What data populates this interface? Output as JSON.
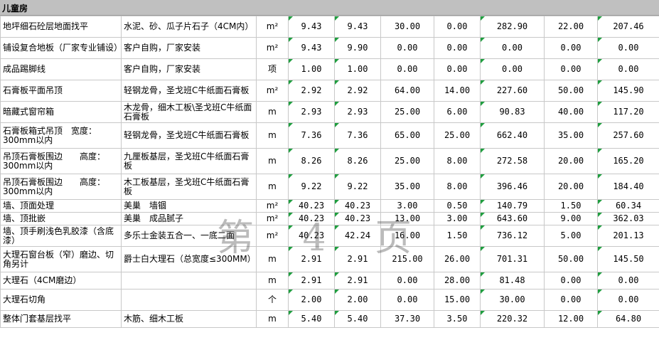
{
  "section": {
    "title": "儿童房"
  },
  "watermark": "第 4 页",
  "rows": [
    {
      "name": "地坪细石砼层地面找平",
      "material": "水泥、砂、瓜子片石子（4CM内）",
      "unit": "m²",
      "v1": "9.43",
      "v2": "9.43",
      "v3": "30.00",
      "v4": "0.00",
      "v5": "282.90",
      "v6": "22.00",
      "v7": "207.46"
    },
    {
      "name": "铺设复合地板（厂家专业铺设）",
      "material": "客户自购，厂家安装",
      "unit": "m²",
      "v1": "9.43",
      "v2": "9.90",
      "v3": "0.00",
      "v4": "0.00",
      "v5": "0.00",
      "v6": "0.00",
      "v7": "0.00"
    },
    {
      "name": "成品踢脚线",
      "material": "客户自购，厂家安装",
      "unit": "项",
      "v1": "1.00",
      "v2": "1.00",
      "v3": "0.00",
      "v4": "0.00",
      "v5": "0.00",
      "v6": "0.00",
      "v7": "0.00"
    },
    {
      "name": "石膏板平面吊顶",
      "material": "轻钢龙骨，圣戈班C牛纸面石膏板",
      "unit": "m²",
      "v1": "2.92",
      "v2": "2.92",
      "v3": "64.00",
      "v4": "14.00",
      "v5": "227.60",
      "v6": "50.00",
      "v7": "145.90"
    },
    {
      "name": "暗藏式窗帘箱",
      "material": "木龙骨，细木工板\\圣戈班C牛纸面石膏板",
      "unit": "m",
      "v1": "2.93",
      "v2": "2.93",
      "v3": "25.00",
      "v4": "6.00",
      "v5": "90.83",
      "v6": "40.00",
      "v7": "117.20"
    },
    {
      "name": "石膏板箱式吊顶　宽度：300mm以内",
      "material": "轻钢龙骨，圣戈班C牛纸面石膏板",
      "unit": "m",
      "v1": "7.36",
      "v2": "7.36",
      "v3": "65.00",
      "v4": "25.00",
      "v5": "662.40",
      "v6": "35.00",
      "v7": "257.60"
    },
    {
      "name": "吊顶石膏板围边　　高度：300mm以内",
      "material": "九厘板基层，圣戈班C牛纸面石膏板",
      "unit": "m",
      "v1": "8.26",
      "v2": "8.26",
      "v3": "25.00",
      "v4": "8.00",
      "v5": "272.58",
      "v6": "20.00",
      "v7": "165.20"
    },
    {
      "name": "吊顶石膏板围边　　高度：300mm以内",
      "material": "木工板基层，圣戈班C牛纸面石膏板",
      "unit": "m",
      "v1": "9.22",
      "v2": "9.22",
      "v3": "35.00",
      "v4": "8.00",
      "v5": "396.46",
      "v6": "20.00",
      "v7": "184.40"
    },
    {
      "name": "墙、顶面处理",
      "material": "美巢　墙锢",
      "unit": "m²",
      "v1": "40.23",
      "v2": "40.23",
      "v3": "3.00",
      "v4": "0.50",
      "v5": "140.79",
      "v6": "1.50",
      "v7": "60.34"
    },
    {
      "name": "墙、顶批嵌",
      "material": "美巢　成品腻子",
      "unit": "m²",
      "v1": "40.23",
      "v2": "40.23",
      "v3": "13.00",
      "v4": "3.00",
      "v5": "643.60",
      "v6": "9.00",
      "v7": "362.03"
    },
    {
      "name": "墙、顶手刷浅色乳胶漆（含底漆）",
      "material": "多乐士金装五合一、一底二面",
      "unit": "m²",
      "v1": "40.23",
      "v2": "42.24",
      "v3": "16.00",
      "v4": "1.50",
      "v5": "736.12",
      "v6": "5.00",
      "v7": "201.13"
    },
    {
      "name": "大理石窗台板（窄）磨边、切角另计",
      "material": "爵士白大理石（总宽度≤300MM）",
      "unit": "m",
      "v1": "2.91",
      "v2": "2.91",
      "v3": "215.00",
      "v4": "26.00",
      "v5": "701.31",
      "v6": "50.00",
      "v7": "145.50"
    },
    {
      "name": "大理石（4CM磨边）",
      "material": "",
      "unit": "m",
      "v1": "2.91",
      "v2": "2.91",
      "v3": "0.00",
      "v4": "28.00",
      "v5": "81.48",
      "v6": "0.00",
      "v7": "0.00"
    },
    {
      "name": "大理石切角",
      "material": "",
      "unit": "个",
      "v1": "2.00",
      "v2": "2.00",
      "v3": "0.00",
      "v4": "15.00",
      "v5": "30.00",
      "v6": "0.00",
      "v7": "0.00"
    },
    {
      "name": "整体门套基层找平",
      "material": "木筋、细木工板",
      "unit": "m",
      "v1": "5.40",
      "v2": "5.40",
      "v3": "37.30",
      "v4": "3.50",
      "v5": "220.32",
      "v6": "12.00",
      "v7": "64.80"
    }
  ]
}
